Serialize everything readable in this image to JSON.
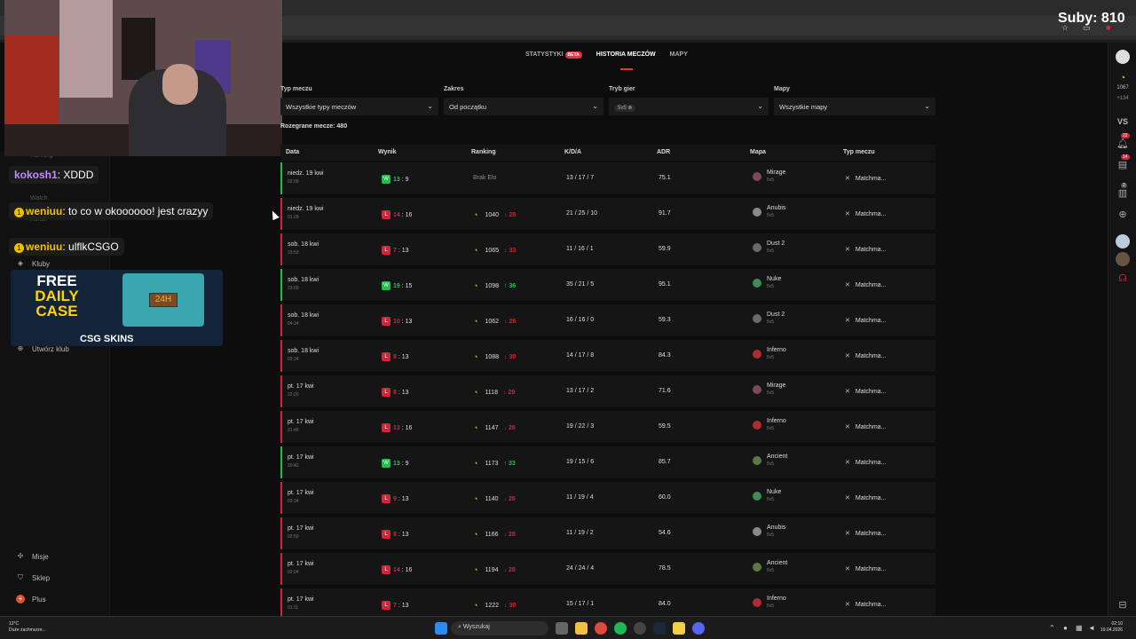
{
  "stream_overlay": {
    "subs": "Suby: 810",
    "chat": [
      {
        "user": "kokosh1",
        "message": "XDDD"
      },
      {
        "user": "weniuu",
        "message": "to co w okoooooo! jest crazyy"
      },
      {
        "user": "weniuu",
        "message": "ulflkCSGO"
      }
    ],
    "ad": {
      "line1": "FREE",
      "line2": "DAILY",
      "line3": "CASE",
      "box_text": "24H",
      "brand": "CSG  SKINS"
    }
  },
  "sidebar": {
    "faint_items": [
      "Ranking",
      "Watch",
      "Kanał"
    ],
    "items": [
      {
        "label": "Kluby",
        "icon": "shield-icon"
      },
      {
        "label": "Utwórz klub",
        "icon": "plus-circle-icon"
      },
      {
        "label": "Misje",
        "icon": "target-icon"
      },
      {
        "label": "Sklep",
        "icon": "cart-icon"
      },
      {
        "label": "Plus",
        "icon": "plus-badge-icon"
      }
    ]
  },
  "tabs": [
    {
      "label": "STATYSTYKI",
      "badge": "BETA",
      "active": false
    },
    {
      "label": "HISTORIA MECZÓW",
      "active": true
    },
    {
      "label": "MAPY",
      "active": false
    }
  ],
  "filters": {
    "match_type": {
      "label": "Typ meczu",
      "value": "Wszystkie typy meczów"
    },
    "range": {
      "label": "Zakres",
      "value": "Od początku"
    },
    "game_mode": {
      "label": "Tryb gier",
      "value": "5v5"
    },
    "maps": {
      "label": "Mapy",
      "value": "Wszystkie mapy"
    }
  },
  "matches_played": "Rozegrane mecze: 480",
  "table": {
    "columns": [
      "Data",
      "Wynik",
      "Ranking",
      "K/D/A",
      "ADR",
      "Mapa",
      "Typ meczu"
    ],
    "rows": [
      {
        "date": "niedz. 19 kwi",
        "time": "02:09",
        "result": "W",
        "own": "13",
        "opp": "9",
        "rank": "Brak Elo",
        "delta": "",
        "kda": "13 / 17 / 7",
        "adr": "75.1",
        "map": "Mirage",
        "mode": "5v5",
        "type": "Matchma..."
      },
      {
        "date": "niedz. 19 kwi",
        "time": "01:29",
        "result": "L",
        "own": "14",
        "opp": "16",
        "rank": "1040",
        "delta": "25",
        "kda": "21 / 25 / 10",
        "adr": "91.7",
        "map": "Anubis",
        "mode": "5v5",
        "type": "Matchma..."
      },
      {
        "date": "sob. 18 kwi",
        "time": "23:53",
        "result": "L",
        "own": "7",
        "opp": "13",
        "rank": "1065",
        "delta": "33",
        "kda": "11 / 16 / 1",
        "adr": "59.9",
        "map": "Dust 2",
        "mode": "5v5",
        "type": "Matchma..."
      },
      {
        "date": "sob. 18 kwi",
        "time": "23:09",
        "result": "W",
        "own": "19",
        "opp": "15",
        "rank": "1098",
        "delta": "36",
        "kda": "35 / 21 / 5",
        "adr": "95.1",
        "map": "Nuke",
        "mode": "5v5",
        "type": "Matchma..."
      },
      {
        "date": "sob. 18 kwi",
        "time": "04:14",
        "result": "L",
        "own": "10",
        "opp": "13",
        "rank": "1062",
        "delta": "26",
        "kda": "16 / 16 / 0",
        "adr": "59.3",
        "map": "Dust 2",
        "mode": "5v5",
        "type": "Matchma..."
      },
      {
        "date": "sob. 18 kwi",
        "time": "03:34",
        "result": "L",
        "own": "8",
        "opp": "13",
        "rank": "1088",
        "delta": "30",
        "kda": "14 / 17 / 8",
        "adr": "84.3",
        "map": "Inferno",
        "mode": "5v5",
        "type": "Matchma..."
      },
      {
        "date": "pt. 17 kwi",
        "time": "22:20",
        "result": "L",
        "own": "8",
        "opp": "13",
        "rank": "1118",
        "delta": "29",
        "kda": "13 / 17 / 2",
        "adr": "71.6",
        "map": "Mirage",
        "mode": "5v5",
        "type": "Matchma..."
      },
      {
        "date": "pt. 17 kwi",
        "time": "21:45",
        "result": "L",
        "own": "13",
        "opp": "16",
        "rank": "1147",
        "delta": "26",
        "kda": "19 / 22 / 3",
        "adr": "59.5",
        "map": "Inferno",
        "mode": "5v5",
        "type": "Matchma..."
      },
      {
        "date": "pt. 17 kwi",
        "time": "20:42",
        "result": "W",
        "own": "13",
        "opp": "9",
        "rank": "1173",
        "delta": "33",
        "kda": "19 / 15 / 6",
        "adr": "85.7",
        "map": "Ancient",
        "mode": "5v5",
        "type": "Matchma..."
      },
      {
        "date": "pt. 17 kwi",
        "time": "03:34",
        "result": "L",
        "own": "9",
        "opp": "13",
        "rank": "1140",
        "delta": "26",
        "kda": "11 / 19 / 4",
        "adr": "60.0",
        "map": "Nuke",
        "mode": "5v5",
        "type": "Matchma..."
      },
      {
        "date": "pt. 17 kwi",
        "time": "02:50",
        "result": "L",
        "own": "8",
        "opp": "13",
        "rank": "1166",
        "delta": "28",
        "kda": "11 / 19 / 2",
        "adr": "54.6",
        "map": "Anubis",
        "mode": "5v5",
        "type": "Matchma..."
      },
      {
        "date": "pt. 17 kwi",
        "time": "02:04",
        "result": "L",
        "own": "14",
        "opp": "16",
        "rank": "1194",
        "delta": "28",
        "kda": "24 / 24 / 4",
        "adr": "78.5",
        "map": "Ancient",
        "mode": "5v5",
        "type": "Matchma..."
      },
      {
        "date": "pt. 17 kwi",
        "time": "01:11",
        "result": "L",
        "own": "7",
        "opp": "13",
        "rank": "1222",
        "delta": "30",
        "kda": "15 / 17 / 1",
        "adr": "84.0",
        "map": "Inferno",
        "mode": "5v5",
        "type": "Matchma..."
      }
    ]
  },
  "right_rail": {
    "elo": "1067",
    "elo_delta": "+134",
    "vs": "VS",
    "notif_badge": "22",
    "friends_badge": "14",
    "level_badge": "2"
  },
  "taskbar": {
    "weather_temp": "12°C",
    "weather_desc": "Duże zachmurze...",
    "search": "Wyszukaj",
    "time": "02:10",
    "date": "19.04.2026"
  },
  "colors": {
    "loss": "#d2243b",
    "win": "#1fc04a",
    "accent": "#e9333a",
    "elo": "#e8b800"
  }
}
